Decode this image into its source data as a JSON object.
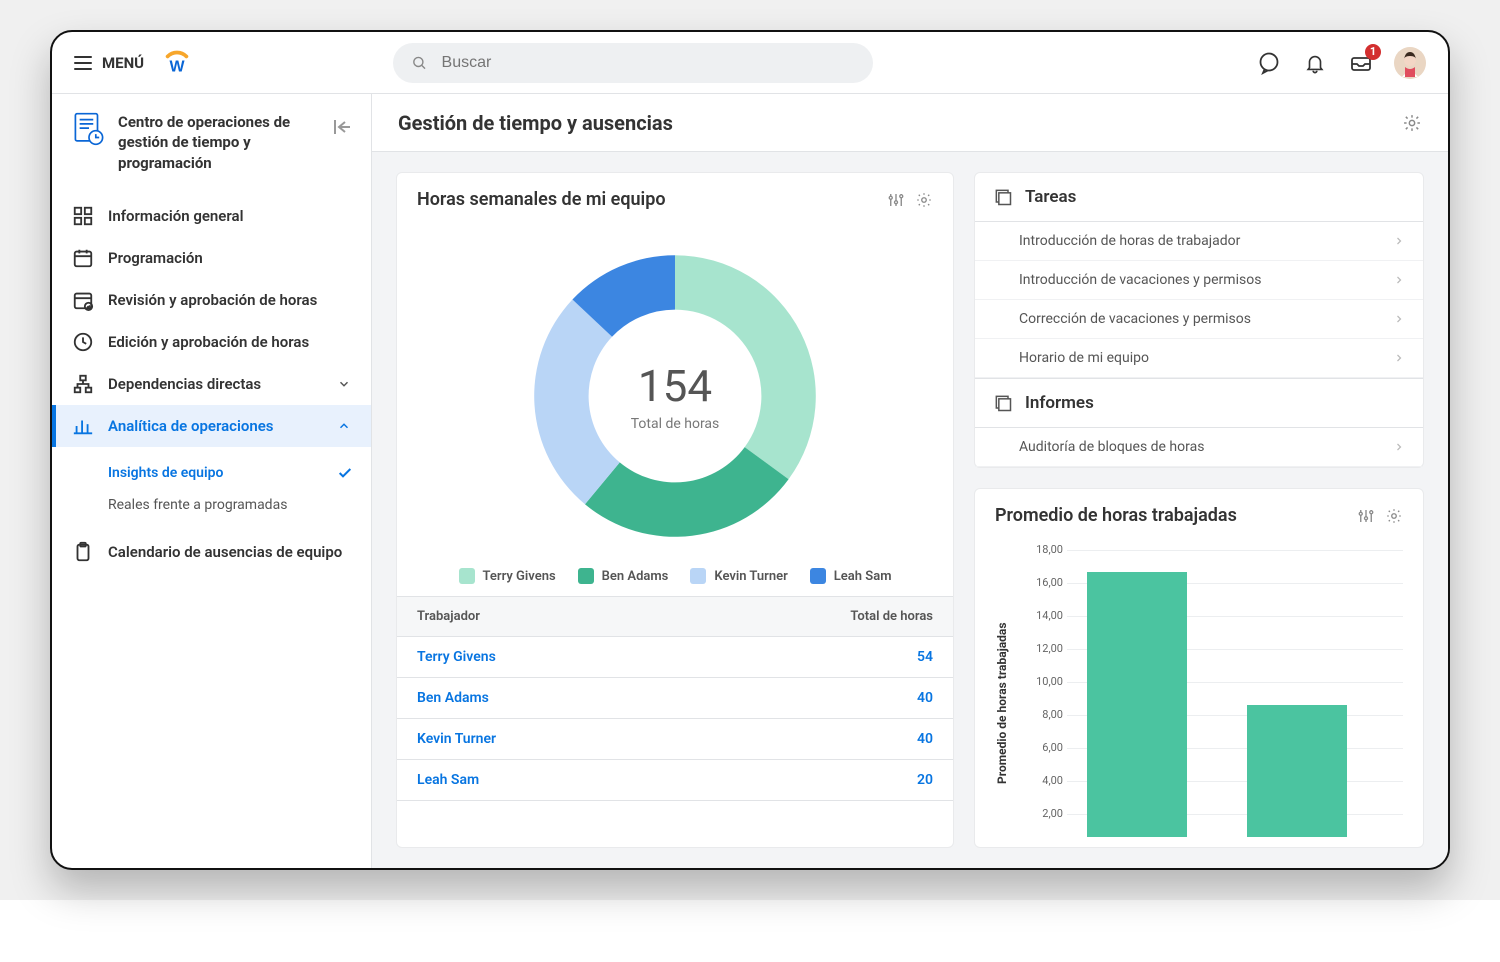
{
  "header": {
    "menu_label": "MENÚ",
    "search_placeholder": "Buscar",
    "inbox_badge": "1"
  },
  "sidebar": {
    "title": "Centro de operaciones de gestión de tiempo y programación",
    "items": [
      {
        "label": "Información general"
      },
      {
        "label": "Programación"
      },
      {
        "label": "Revisión y aprobación de horas"
      },
      {
        "label": "Edición y aprobación de horas"
      },
      {
        "label": "Dependencias directas"
      },
      {
        "label": "Analítica de operaciones"
      },
      {
        "label": "Calendario de ausencias de equipo"
      }
    ],
    "sub_items": [
      {
        "label": "Insights de equipo"
      },
      {
        "label": "Reales frente a programadas"
      }
    ]
  },
  "page": {
    "title": "Gestión de tiempo y ausencias"
  },
  "donut": {
    "title": "Horas semanales de mi equipo",
    "center_value": "154",
    "center_label": "Total de horas",
    "table_headers": [
      "Trabajador",
      "Total de horas"
    ]
  },
  "tasks": {
    "title": "Tareas",
    "items": [
      "Introducción de horas de trabajador",
      "Introducción de vacaciones y permisos",
      "Corrección de vacaciones y permisos",
      "Horario de mi equipo"
    ]
  },
  "reports": {
    "title": "Informes",
    "items": [
      "Auditoría de bloques de horas"
    ]
  },
  "barchart": {
    "title": "Promedio de horas trabajadas",
    "y_title": "Promedio de horas trabajadas"
  },
  "chart_data": [
    {
      "type": "pie",
      "title": "Horas semanales de mi equipo",
      "total_label": "Total de horas",
      "total": 154,
      "series": [
        {
          "name": "Terry Givens",
          "value": 54,
          "color": "#a7e4ce"
        },
        {
          "name": "Ben Adams",
          "value": 40,
          "color": "#3eb48f"
        },
        {
          "name": "Kevin Turner",
          "value": 40,
          "color": "#b9d5f6"
        },
        {
          "name": "Leah Sam",
          "value": 20,
          "color": "#3c86e1"
        }
      ]
    },
    {
      "type": "bar",
      "title": "Promedio de horas trabajadas",
      "ylabel": "Promedio de horas trabajadas",
      "y_ticks": [
        "18,00",
        "16,00",
        "14,00",
        "12,00",
        "10,00",
        "8,00",
        "6,00",
        "4,00",
        "2,00"
      ],
      "ylim": [
        0,
        18
      ],
      "values": [
        16.6,
        8.3
      ]
    }
  ]
}
